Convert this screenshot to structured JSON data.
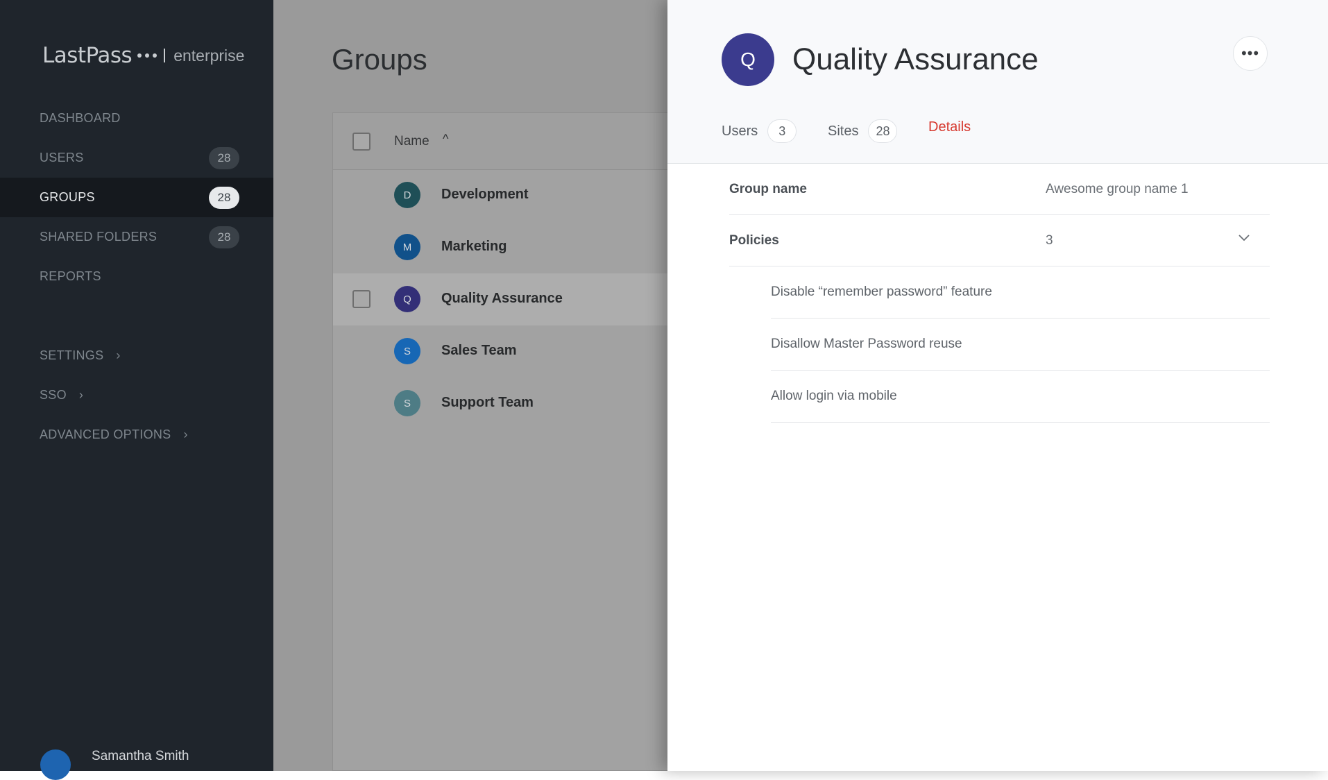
{
  "brand": {
    "logo_text": "LastPass",
    "logo_suffix": "enterprise"
  },
  "sidebar": {
    "items": [
      {
        "label": "DASHBOARD"
      },
      {
        "label": "USERS",
        "badge": "28"
      },
      {
        "label": "GROUPS",
        "badge": "28",
        "active": true
      },
      {
        "label": "SHARED FOLDERS",
        "badge": "28"
      },
      {
        "label": "REPORTS"
      },
      {
        "label": "SETTINGS",
        "chevron": "›"
      },
      {
        "label": "SSO",
        "chevron": "›"
      },
      {
        "label": "ADVANCED OPTIONS",
        "chevron": "›"
      }
    ],
    "user": {
      "name": "Samantha Smith"
    }
  },
  "main": {
    "title": "Groups",
    "table": {
      "header": {
        "name": "Name",
        "sort_icon": "^"
      },
      "rows": [
        {
          "initial": "D",
          "name": "Development",
          "color": "#1f4f57"
        },
        {
          "initial": "M",
          "name": "Marketing",
          "color": "#11518a"
        },
        {
          "initial": "Q",
          "name": "Quality Assurance",
          "color": "#332f77",
          "selected": true
        },
        {
          "initial": "S",
          "name": "Sales Team",
          "color": "#1767b5"
        },
        {
          "initial": "S",
          "name": "Support Team",
          "color": "#4e7c85"
        }
      ]
    }
  },
  "panel": {
    "avatar_initial": "Q",
    "title": "Quality Assurance",
    "more_icon": "•••",
    "tabs": [
      {
        "label": "Users",
        "count": "3"
      },
      {
        "label": "Sites",
        "count": "28"
      },
      {
        "label": "Details",
        "active": true
      }
    ],
    "details": {
      "group_name_label": "Group name",
      "group_name_value": "Awesome group name 1",
      "policies_label": "Policies",
      "policies_count": "3",
      "policies": [
        "Disable “remember password” feature",
        "Disallow Master Password reuse",
        "Allow login via mobile"
      ]
    }
  },
  "colors": {
    "accent": "#d6382e",
    "sidebar_bg": "#1f252c",
    "avatar_qa": "#3b3b8e"
  }
}
